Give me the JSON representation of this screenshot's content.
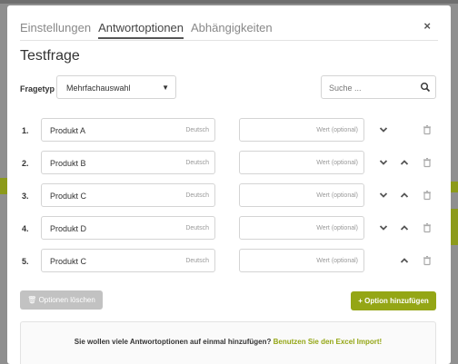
{
  "tabs": [
    {
      "label": "Einstellungen",
      "active": false
    },
    {
      "label": "Antwortoptionen",
      "active": true
    },
    {
      "label": "Abhängigkeiten",
      "active": false
    }
  ],
  "close_glyph": "×",
  "title": "Testfrage",
  "fragetyp": {
    "label": "Fragetyp",
    "value": "Mehrfachauswahl"
  },
  "search": {
    "placeholder": "Suche ..."
  },
  "options": [
    {
      "num": "1.",
      "name": "Produkt A",
      "lang": "Deutsch",
      "value_placeholder": "Wert (optional)",
      "controls": [
        "down",
        "trash"
      ]
    },
    {
      "num": "2.",
      "name": "Produkt B",
      "lang": "Deutsch",
      "value_placeholder": "Wert (optional)",
      "controls": [
        "down",
        "up",
        "trash"
      ]
    },
    {
      "num": "3.",
      "name": "Produkt C",
      "lang": "Deutsch",
      "value_placeholder": "Wert (optional)",
      "controls": [
        "down",
        "up",
        "trash"
      ]
    },
    {
      "num": "4.",
      "name": "Produkt D",
      "lang": "Deutsch",
      "value_placeholder": "Wert (optional)",
      "controls": [
        "down",
        "up",
        "trash"
      ]
    },
    {
      "num": "5.",
      "name": "Produkt C",
      "lang": "Deutsch",
      "value_placeholder": "Wert (optional)",
      "controls": [
        "up",
        "trash"
      ]
    }
  ],
  "buttons": {
    "clear_label": "Optionen löschen",
    "add_label": "Option hinzufügen"
  },
  "info": {
    "text": "Sie wollen viele Antwortoptionen auf einmal hinzufügen?",
    "link": "Benutzen Sie den Excel Import!"
  },
  "colors": {
    "accent": "#94a615",
    "disabled": "#c2c2c2",
    "overlay": "#8f8f8f"
  }
}
